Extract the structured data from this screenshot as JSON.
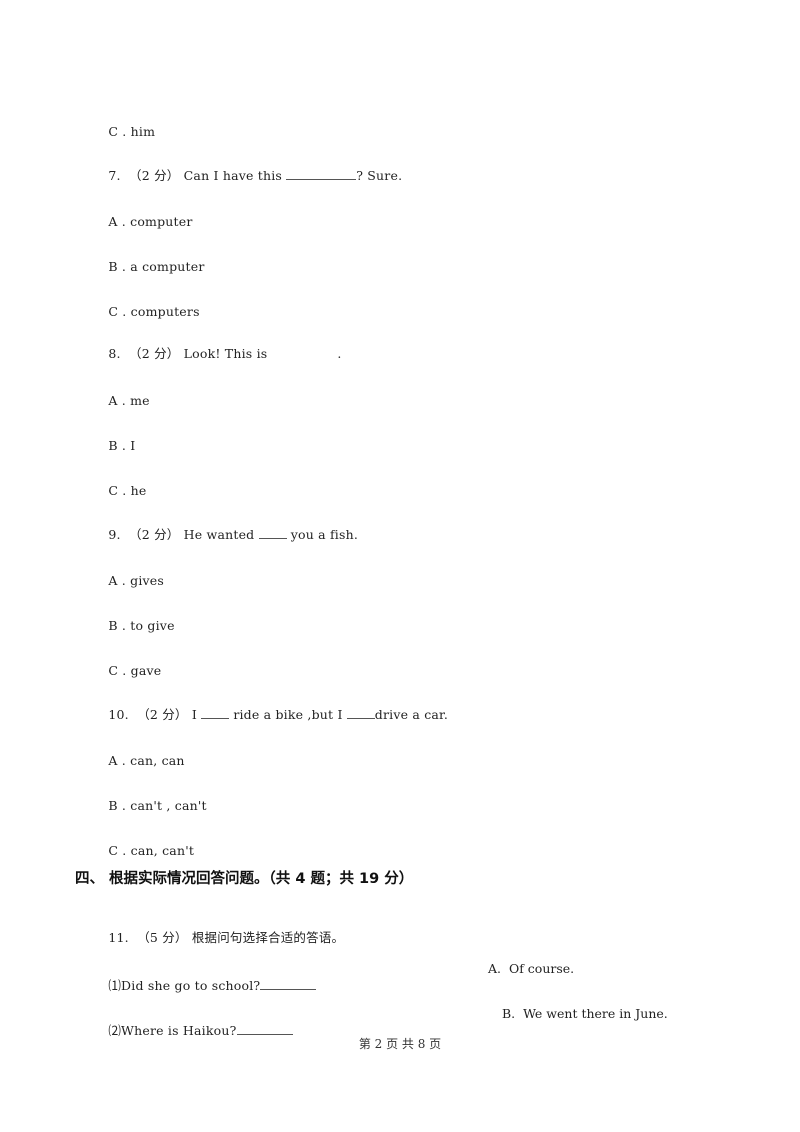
{
  "questions": [
    {
      "prev_option": {
        "letter": "C",
        "text": "him"
      }
    },
    {
      "number": "7.",
      "score": "（2 分）",
      "stem_before": "Can I have this ",
      "stem_after": "? Sure.",
      "options": [
        {
          "letter": "A",
          "text": "computer"
        },
        {
          "letter": "B",
          "text": "a computer"
        },
        {
          "letter": "C",
          "text": "computers"
        }
      ]
    },
    {
      "number": "8.",
      "score": "（2 分）",
      "stem_before": "Look! This is",
      "stem_after": ".",
      "options": [
        {
          "letter": "A",
          "text": "me"
        },
        {
          "letter": "B",
          "text": "I"
        },
        {
          "letter": "C",
          "text": "he"
        }
      ]
    },
    {
      "number": "9.",
      "score": "（2 分）",
      "stem_before": "He wanted ",
      "stem_after": " you a fish.",
      "options": [
        {
          "letter": "A",
          "text": "gives"
        },
        {
          "letter": "B",
          "text": "to give"
        },
        {
          "letter": "C",
          "text": "gave"
        }
      ]
    },
    {
      "number": "10.",
      "score": "（2 分）",
      "stem_part1": "I ",
      "stem_part2": " ride a bike ,but I ",
      "stem_part3": "drive a car.",
      "options": [
        {
          "letter": "A",
          "text": "can, can"
        },
        {
          "letter": "B",
          "text": "can't , can't"
        },
        {
          "letter": "C",
          "text": "can, can't"
        }
      ]
    }
  ],
  "section": {
    "title": "四、 根据实际情况回答问题。（共 4 题；共 19 分）"
  },
  "q11": {
    "number": "11.",
    "score": "（5 分）",
    "instruction": "根据问句选择合适的答语。",
    "items": [
      {
        "question": "⑴Did she go to school?",
        "answer": "A.  Of course."
      },
      {
        "question": "⑵Where is Haikou?",
        "answer": "B.  We went there in June."
      }
    ]
  },
  "footer": {
    "page_text": "第 2 页 共 8 页"
  },
  "option_separator": " . "
}
